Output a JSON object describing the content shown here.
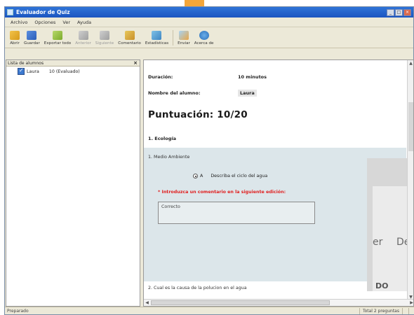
{
  "window": {
    "title": "Evaluador de Quiz",
    "controls": {
      "minimize": "_",
      "maximize": "□",
      "close": "×"
    }
  },
  "menu": [
    "Archivo",
    "Opciones",
    "Ver",
    "Ayuda"
  ],
  "toolbar": [
    {
      "label": "Abrir",
      "icon": "open-folder-icon",
      "enabled": true
    },
    {
      "label": "Guardar",
      "icon": "save-icon",
      "enabled": true
    },
    {
      "label": "Exportar todo",
      "icon": "export-icon",
      "enabled": true
    },
    {
      "label": "Anterior",
      "icon": "up-arrow-icon",
      "enabled": false
    },
    {
      "label": "Siguiente",
      "icon": "down-arrow-icon",
      "enabled": false
    },
    {
      "label": "Comentario",
      "icon": "comment-icon",
      "enabled": true
    },
    {
      "label": "Estadísticas",
      "icon": "statistics-icon",
      "enabled": true
    },
    {
      "label": "Enviar",
      "icon": "send-icon",
      "enabled": true
    },
    {
      "label": "Acerca de",
      "icon": "about-icon",
      "enabled": true
    }
  ],
  "student_list": {
    "header": "Lista de alumnos",
    "close": "×",
    "students": [
      {
        "name": "Laura",
        "status": "10 (Evaluado)"
      }
    ]
  },
  "report": {
    "duration_label": "Duración:",
    "duration_value": "10 minutos",
    "student_label": "Nombre del alumno:",
    "student_value": "Laura",
    "score": "Puntuación: 10/20",
    "section": "1. Ecología",
    "question1": "1. Medio Ambiente",
    "answer_letter": "A",
    "answer_text": "Describa el ciclo del agua",
    "warning": "* Introduzca un comentario en la siguiente edición:",
    "comment": "Correcto",
    "question2": "2. Cual es la causa de la polucion en el agua",
    "overlay_text": [
      "er",
      "De",
      "DO"
    ]
  },
  "status": {
    "left": "Preparado",
    "right": "Total 2 preguntas"
  }
}
